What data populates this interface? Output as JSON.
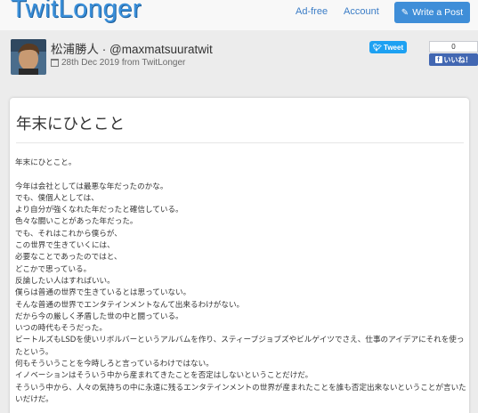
{
  "navbar": {
    "logo": "TwitLonger",
    "links": [
      "Ad-free",
      "Account"
    ],
    "write_button": "Write a Post"
  },
  "post": {
    "author": "松浦勝人 · @maxmatsuuratwit",
    "date": "28th Dec 2019 from TwitLonger",
    "title": "年末にひとこと",
    "body": [
      "年末にひとこと。",
      "",
      "今年は会社としては最悪な年だったのかな。",
      "でも、僕個人としては、",
      "より自分が強くなれた年だったと確信している。",
      "色々な闘いことがあった年だった。",
      "でも、それはこれから僕らが、",
      "この世界で生きていくには、",
      "必要なことであったのではと、",
      "どこかで思っている。",
      "反論したい人はすればいい。",
      "僕らは普通の世界で生きているとは思っていない。",
      "そんな普通の世界でエンタテインメントなんて出来るわけがない。",
      "だから今の厳しく矛盾した世の中と闘っている。",
      "いつの時代もそうだった。",
      "ビートルズもLSDを使いリボルバーというアルバムを作り、スティーブジョブズやビルゲイツでさえ、仕事のアイデアにそれを使ったという。",
      "何もそういうことを今時しろと言っているわけではない。",
      "イノベーションはそういう中から産まれてきたことを否定はしないということだけだ。",
      "そういう中から、人々の気持ちの中に永遠に残るエンタテインメントの世界が産まれたことを誰も否定出来ないということが言いたいだけだ。"
    ]
  },
  "share": {
    "tweet_label": "Tweet",
    "like_count": "0",
    "like_label": "いいね！"
  },
  "colors": {
    "brand": "#3a8fd9",
    "write_button": "#3f8ed8",
    "twitter": "#1da1f2",
    "facebook": "#4267b2"
  }
}
